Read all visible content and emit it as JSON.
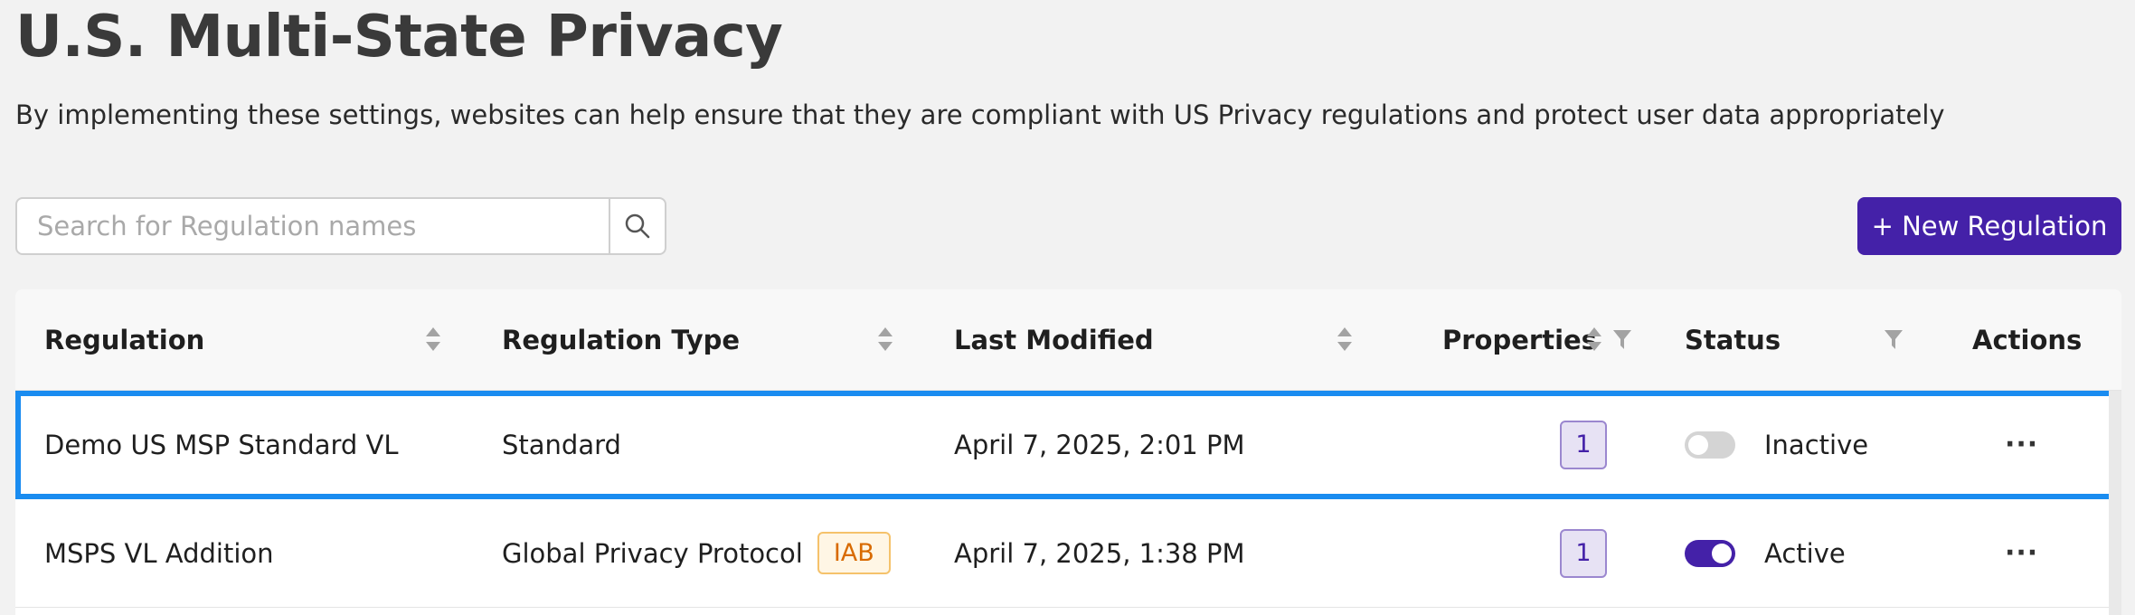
{
  "page": {
    "title": "U.S. Multi-State Privacy",
    "description": "By implementing these settings, websites can help ensure that they are compliant with US Privacy regulations and protect user data appropriately"
  },
  "search": {
    "placeholder": "Search for Regulation names",
    "value": ""
  },
  "toolbar": {
    "new_regulation_label": "+ New Regulation"
  },
  "table": {
    "columns": {
      "regulation": "Regulation",
      "regulation_type": "Regulation Type",
      "last_modified": "Last Modified",
      "properties": "Properties",
      "status": "Status",
      "actions": "Actions"
    },
    "rows": [
      {
        "name": "Demo US MSP Standard VL",
        "type": "Standard",
        "type_tag": "",
        "last_modified": "April 7, 2025, 2:01 PM",
        "properties": "1",
        "status": "Inactive",
        "active": false,
        "actions": "···",
        "selected": true
      },
      {
        "name": "MSPS VL Addition",
        "type": "Global Privacy Protocol",
        "type_tag": "IAB",
        "last_modified": "April 7, 2025, 1:38 PM",
        "properties": "1",
        "status": "Active",
        "active": true,
        "actions": "···",
        "selected": false
      }
    ]
  },
  "colors": {
    "accent": "#4421a8",
    "selection_outline": "#1a8cf0",
    "iab_tag_text": "#d86a00",
    "iab_tag_bg": "#fff6e5"
  },
  "icons": {
    "search": "search-icon",
    "sort": "sort-icon",
    "filter": "filter-icon",
    "more": "more-actions-icon"
  }
}
